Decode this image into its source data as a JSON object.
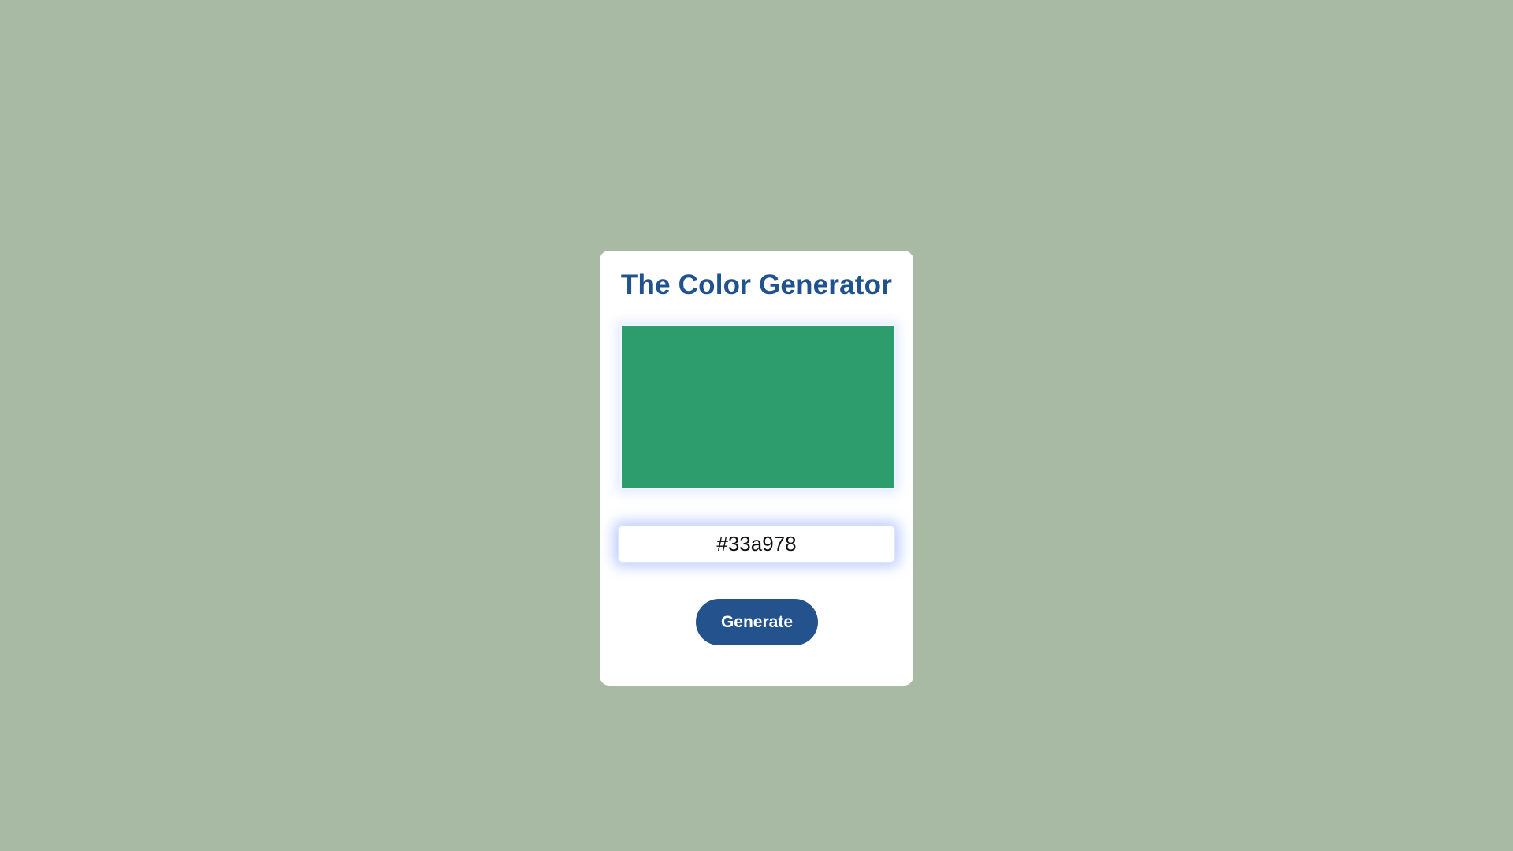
{
  "app": {
    "title": "The Color Generator"
  },
  "swatch": {
    "color": "#2e9d6e"
  },
  "hex_input": {
    "value": "#33a978",
    "placeholder": ""
  },
  "generate_button": {
    "label": "Generate",
    "color": "#23528d"
  },
  "theme": {
    "page_background": "#a9baa4",
    "card_background": "#ffffff",
    "title_color": "#20528f"
  }
}
